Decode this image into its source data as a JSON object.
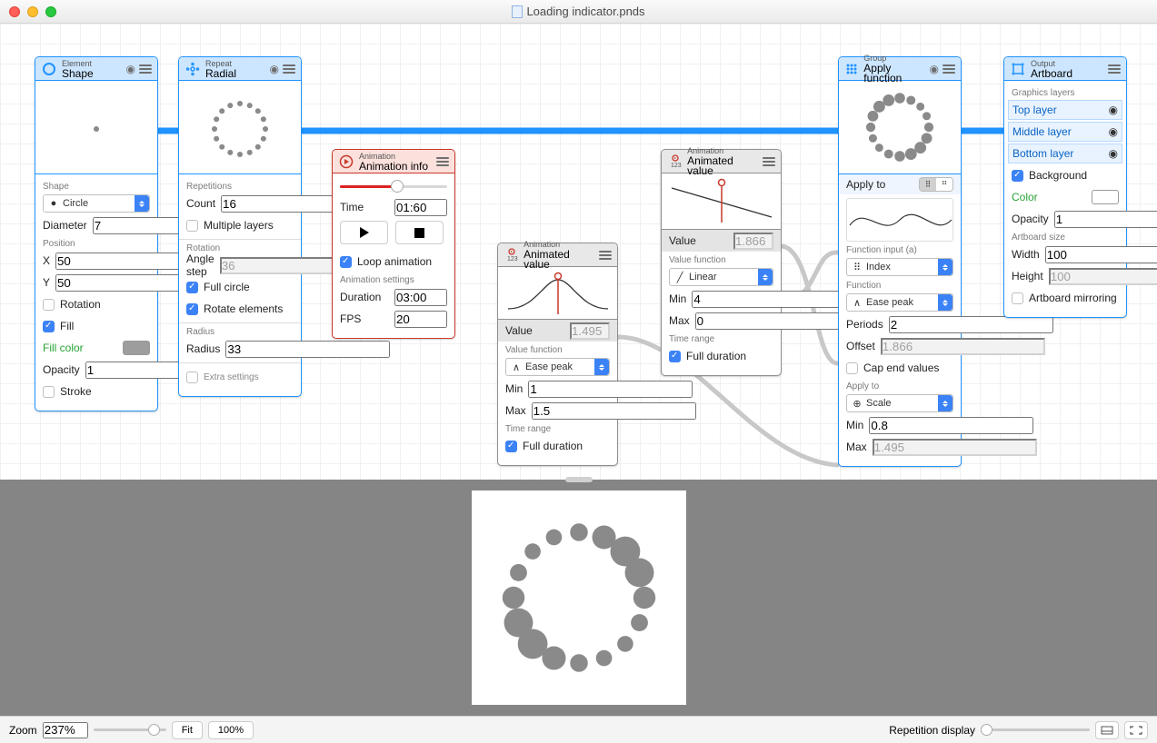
{
  "window": {
    "title": "Loading indicator.pnds"
  },
  "nodes": {
    "shape": {
      "cat": "Element",
      "name": "Shape",
      "labels": {
        "shape": "Shape",
        "diameter": "Diameter",
        "position": "Position",
        "x": "X",
        "y": "Y",
        "rotation": "Rotation",
        "fill": "Fill",
        "fill_color": "Fill color",
        "opacity": "Opacity",
        "stroke": "Stroke"
      },
      "shape_sel": "Circle",
      "diameter": "7",
      "x": "50",
      "y": "50",
      "rotation": false,
      "fill": true,
      "opacity": "1",
      "stroke": false
    },
    "radial": {
      "cat": "Repeat",
      "name": "Radial",
      "labels": {
        "repetitions": "Repetitions",
        "count": "Count",
        "multiple": "Multiple layers",
        "rotation": "Rotation",
        "angle_step": "Angle step",
        "full_circle": "Full circle",
        "rotate_elems": "Rotate elements",
        "radius_sec": "Radius",
        "radius": "Radius",
        "extra": "Extra settings"
      },
      "count": "16",
      "multiple": false,
      "angle_step": "36",
      "full_circle": true,
      "rotate_elems": true,
      "radius": "33",
      "extra": false
    },
    "anim_info": {
      "cat": "Animation",
      "name": "Animation info",
      "labels": {
        "time": "Time",
        "loop": "Loop animation",
        "settings": "Animation settings",
        "duration": "Duration",
        "fps": "FPS"
      },
      "time": "01:60",
      "loop": true,
      "duration": "03:00",
      "fps": "20"
    },
    "anim_val1": {
      "cat": "Animation",
      "name": "Animated value",
      "labels": {
        "value": "Value",
        "func": "Value function",
        "min": "Min",
        "max": "Max",
        "range": "Time range",
        "full": "Full duration"
      },
      "value": "1.495",
      "func": "Ease peak",
      "min": "1",
      "max": "1.5",
      "full": true
    },
    "anim_val2": {
      "cat": "Animation",
      "name": "Animated value",
      "labels": {
        "value": "Value",
        "func": "Value function",
        "min": "Min",
        "max": "Max",
        "range": "Time range",
        "full": "Full duration"
      },
      "value": "1.866",
      "func": "Linear",
      "min": "4",
      "max": "0",
      "full": true
    },
    "apply_fn": {
      "cat": "Group",
      "name": "Apply function",
      "labels": {
        "apply_to": "Apply to",
        "fn_input": "Function input (a)",
        "function": "Function",
        "periods": "Periods",
        "offset": "Offset",
        "cap": "Cap end values",
        "apply_to2": "Apply to",
        "min": "Min",
        "max": "Max"
      },
      "fn_input": "Index",
      "function": "Ease peak",
      "periods": "2",
      "offset": "1.866",
      "cap": false,
      "apply_target": "Scale",
      "min": "0.8",
      "max": "1.495"
    },
    "artboard": {
      "cat": "Output",
      "name": "Artboard",
      "labels": {
        "layers": "Graphics layers",
        "bg": "Background",
        "color": "Color",
        "opacity": "Opacity",
        "size": "Artboard size",
        "width": "Width",
        "height": "Height",
        "mirror": "Artboard mirroring"
      },
      "layers": [
        "Top layer",
        "Middle layer",
        "Bottom layer"
      ],
      "bg": true,
      "opacity": "1",
      "width": "100",
      "height": "100",
      "mirror": false
    }
  },
  "footer": {
    "zoom_label": "Zoom",
    "zoom_value": "237%",
    "fit": "Fit",
    "hundred": "100%",
    "rep_label": "Repetition display"
  }
}
